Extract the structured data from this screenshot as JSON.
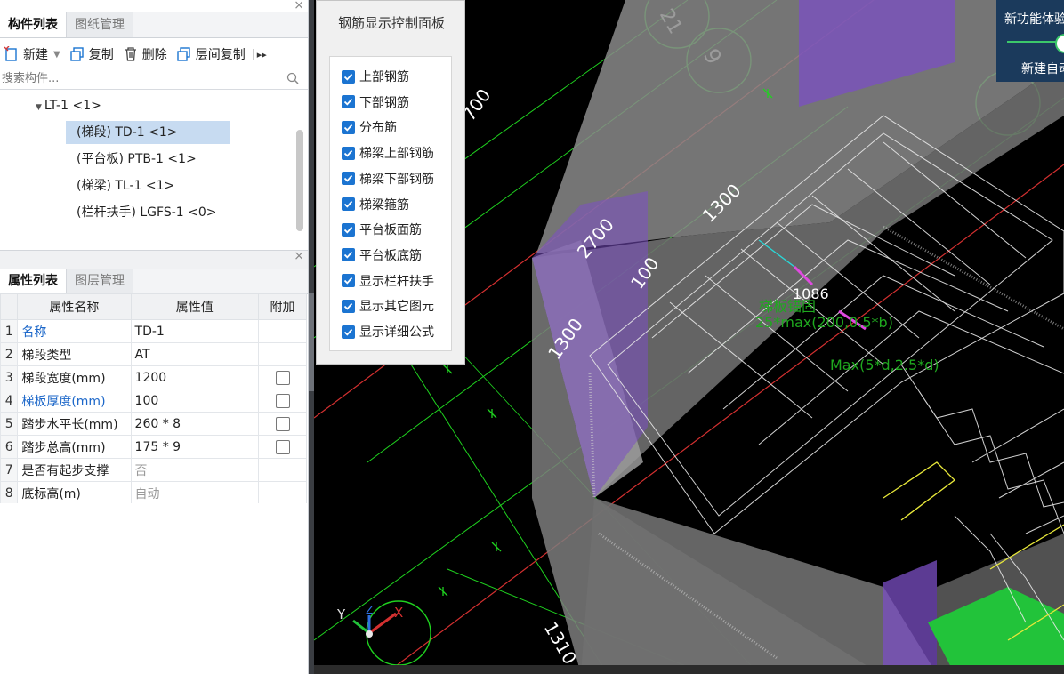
{
  "component_panel": {
    "tabs": [
      "构件列表",
      "图纸管理"
    ],
    "toolbar": {
      "new": "新建",
      "copy": "复制",
      "delete": "删除",
      "floor_copy": "层间复制",
      "more": "▸▸"
    },
    "search_placeholder": "搜索构件...",
    "tree": {
      "root": "LT-1 <1>",
      "children": [
        "(梯段) TD-1 <1>",
        "(平台板) PTB-1 <1>",
        "(梯梁) TL-1 <1>",
        "(栏杆扶手) LGFS-1 <0>"
      ],
      "selected_index": 0
    }
  },
  "property_panel": {
    "tabs": [
      "属性列表",
      "图层管理"
    ],
    "columns": [
      "属性名称",
      "属性值",
      "附加"
    ],
    "rows": [
      {
        "n": "1",
        "name": "名称",
        "value": "TD-1",
        "has_check": false,
        "name_blue": true,
        "value_gray": false
      },
      {
        "n": "2",
        "name": "梯段类型",
        "value": "AT",
        "has_check": false,
        "name_blue": false,
        "value_gray": false
      },
      {
        "n": "3",
        "name": "梯段宽度(mm)",
        "value": "1200",
        "has_check": true,
        "name_blue": false,
        "value_gray": false
      },
      {
        "n": "4",
        "name": "梯板厚度(mm)",
        "value": "100",
        "has_check": true,
        "name_blue": true,
        "value_gray": false
      },
      {
        "n": "5",
        "name": "踏步水平长(mm)",
        "value": "260 * 8",
        "has_check": true,
        "name_blue": false,
        "value_gray": false
      },
      {
        "n": "6",
        "name": "踏步总高(mm)",
        "value": "175 * 9",
        "has_check": true,
        "name_blue": false,
        "value_gray": false
      },
      {
        "n": "7",
        "name": "是否有起步支撑",
        "value": "否",
        "has_check": false,
        "name_blue": false,
        "value_gray": true
      },
      {
        "n": "8",
        "name": "底标高(m)",
        "value": "自动",
        "has_check": false,
        "name_blue": false,
        "value_gray": true
      }
    ]
  },
  "rebar_panel": {
    "title": "钢筋显示控制面板",
    "options": [
      "上部钢筋",
      "下部钢筋",
      "分布筋",
      "梯梁上部钢筋",
      "梯梁下部钢筋",
      "梯梁箍筋",
      "平台板面筋",
      "平台板底筋",
      "显示栏杆扶手",
      "显示其它图元",
      "显示详细公式"
    ]
  },
  "new_feature": {
    "line1": "新功能体验",
    "line2": "新建自动"
  },
  "viewport": {
    "dims": [
      "700",
      "1300",
      "2700",
      "100",
      "1300",
      "1310"
    ],
    "axis_labels": [
      "21",
      "9"
    ],
    "annotation_value": "1086",
    "annotation_line1": "梯板锚固",
    "annotation_line2": "25*max(200,0.5*b)",
    "annotation_line3": "Max(5*d,2.5*d)",
    "axis": {
      "x": "X",
      "y": "Y",
      "z": "Z"
    },
    "colors": {
      "purple": "#7b4fc4",
      "green_line": "#1fd21f",
      "red_line": "#d43030",
      "cyan": "#2bd6d6"
    }
  }
}
